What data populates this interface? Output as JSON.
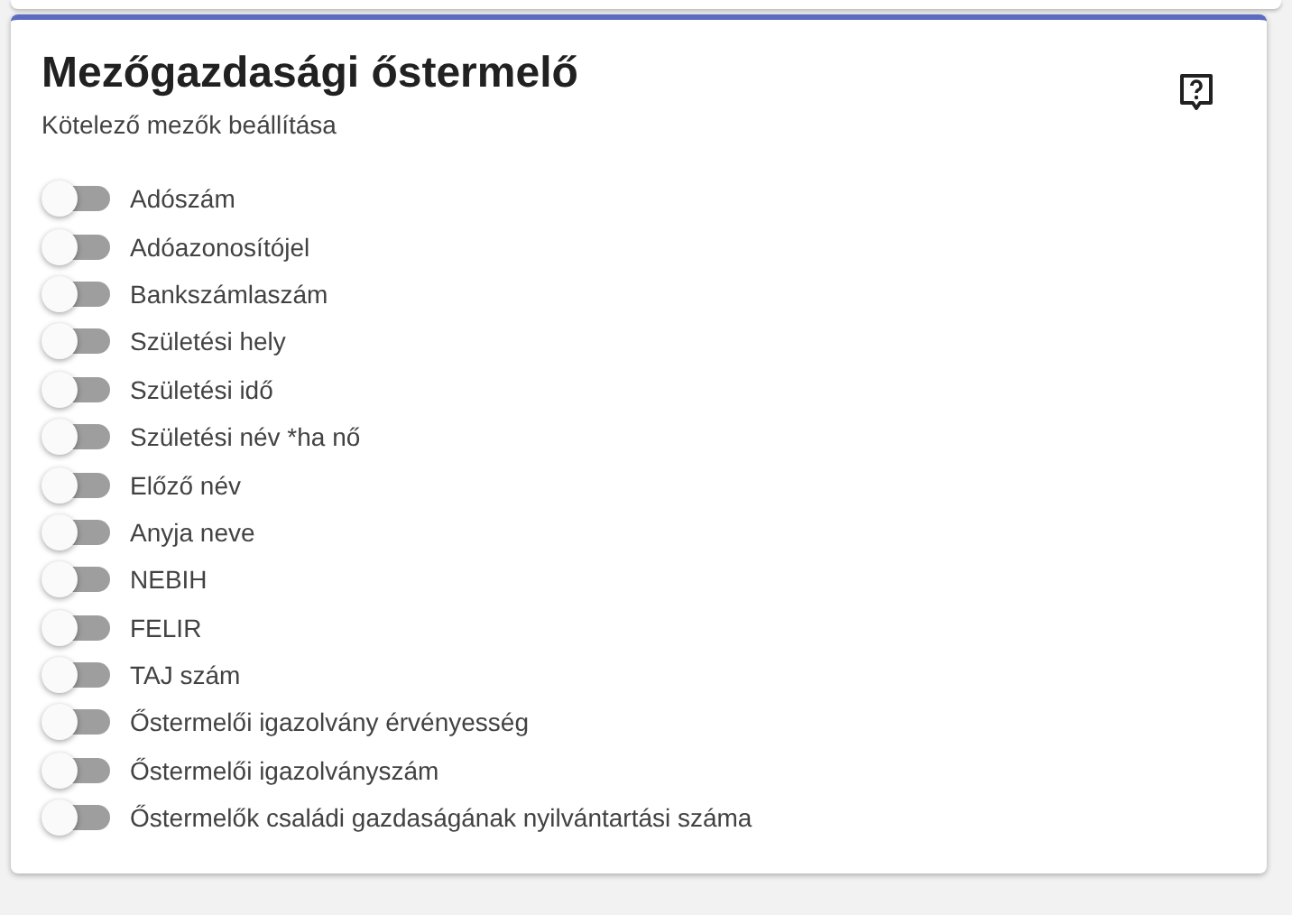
{
  "card": {
    "title": "Mezőgazdasági őstermelő",
    "subtitle": "Kötelező mezők beállítása",
    "toggles": [
      {
        "label": "Adószám",
        "on": false
      },
      {
        "label": "Adóazonosítójel",
        "on": false
      },
      {
        "label": "Bankszámlaszám",
        "on": false
      },
      {
        "label": "Születési hely",
        "on": false
      },
      {
        "label": "Születési idő",
        "on": false
      },
      {
        "label": "Születési név *ha nő",
        "on": false
      },
      {
        "label": "Előző név",
        "on": false
      },
      {
        "label": "Anyja neve",
        "on": false
      },
      {
        "label": "NEBIH",
        "on": false
      },
      {
        "label": "FELIR",
        "on": false
      },
      {
        "label": "TAJ szám",
        "on": false
      },
      {
        "label": "Őstermelői igazolvány érvényesség",
        "on": false
      },
      {
        "label": "Őstermelői igazolványszám",
        "on": false
      },
      {
        "label": "Őstermelők családi gazdaságának nyilvántartási száma",
        "on": false
      }
    ]
  }
}
